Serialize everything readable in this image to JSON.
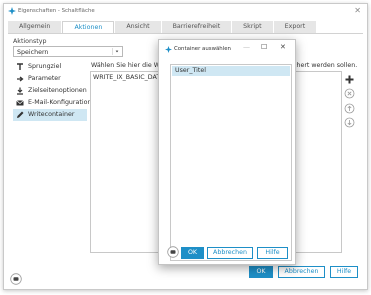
{
  "window": {
    "title": "Eigenschaften - Schaltfläche"
  },
  "tabs": [
    {
      "label": "Allgemein"
    },
    {
      "label": "Aktionen",
      "active": true
    },
    {
      "label": "Ansicht"
    },
    {
      "label": "Barrierefreiheit"
    },
    {
      "label": "Skript"
    },
    {
      "label": "Export"
    }
  ],
  "action_type": {
    "label": "Aktionstyp",
    "value": "Speichern"
  },
  "nav": [
    {
      "label": "Sprungziel",
      "icon": "sprungziel-icon"
    },
    {
      "label": "Parameter",
      "icon": "arrow-right-icon"
    },
    {
      "label": "Zielseitenoptionen",
      "icon": "download-icon"
    },
    {
      "label": "E-Mail-Konfiguration",
      "icon": "email-icon"
    },
    {
      "label": "Writecontainer",
      "icon": "pencil-icon",
      "active": true
    }
  ],
  "content": {
    "description_left": "Wählen Sie hier die Writecon",
    "description_right": "chert werden sollen.",
    "list_entry": "WRITE_IX_BASIC_DATAGROU"
  },
  "side_buttons": [
    "add-icon",
    "remove-icon",
    "move-up-icon",
    "move-down-icon"
  ],
  "footer": {
    "ok": "OK",
    "cancel": "Abbrechen",
    "help": "Hilfe"
  },
  "dialog": {
    "title": "Container auswählen",
    "items": [
      "User_Titel"
    ],
    "ok": "OK",
    "cancel": "Abbrechen",
    "help": "Hilfe"
  },
  "colors": {
    "accent": "#1e8fc7",
    "selection": "#cfe7f3"
  }
}
